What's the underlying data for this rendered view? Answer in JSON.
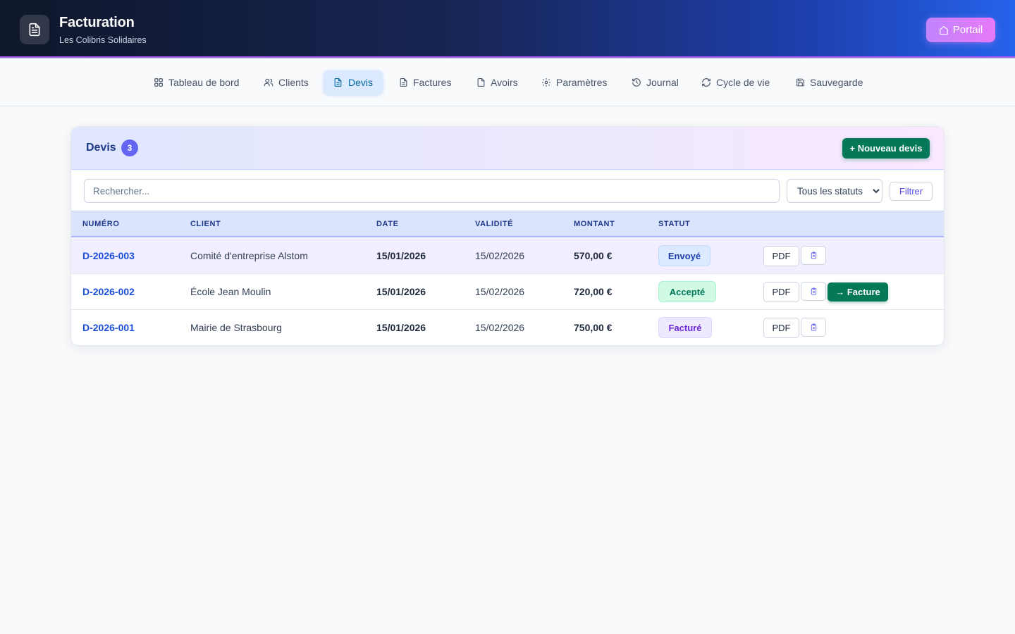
{
  "header": {
    "title": "Facturation",
    "subtitle": "Les Colibris Solidaires",
    "portal_label": "Portail"
  },
  "nav": {
    "items": [
      {
        "label": "Tableau de bord",
        "icon": "grid-icon"
      },
      {
        "label": "Clients",
        "icon": "users-icon"
      },
      {
        "label": "Devis",
        "icon": "document-icon",
        "active": true
      },
      {
        "label": "Factures",
        "icon": "document-icon"
      },
      {
        "label": "Avoirs",
        "icon": "document-icon"
      },
      {
        "label": "Paramètres",
        "icon": "gear-icon"
      },
      {
        "label": "Journal",
        "icon": "history-icon"
      },
      {
        "label": "Cycle de vie",
        "icon": "refresh-icon"
      },
      {
        "label": "Sauvegarde",
        "icon": "save-icon"
      }
    ]
  },
  "panel": {
    "title": "Devis",
    "count": "3",
    "new_button": "+ Nouveau devis",
    "search_placeholder": "Rechercher...",
    "status_filter": "Tous les statuts",
    "filter_button": "Filtrer"
  },
  "table": {
    "headers": [
      "NUMÉRO",
      "CLIENT",
      "DATE",
      "VALIDITÉ",
      "MONTANT",
      "STATUT"
    ],
    "rows": [
      {
        "numero": "D-2026-003",
        "client": "Comité d'entreprise Alstom",
        "date": "15/01/2026",
        "validite": "15/02/2026",
        "montant": "570,00 €",
        "statut": "Envoyé",
        "status_color": "#dbeafe",
        "status_text_color": "#1e40af",
        "pdf": "PDF",
        "convert": ""
      },
      {
        "numero": "D-2026-002",
        "client": "École Jean Moulin",
        "date": "15/01/2026",
        "validite": "15/02/2026",
        "montant": "720,00 €",
        "statut": "Accepté",
        "status_color": "#d1fae5",
        "status_text_color": "#047857",
        "pdf": "PDF",
        "convert": "→ Facture"
      },
      {
        "numero": "D-2026-001",
        "client": "Mairie de Strasbourg",
        "date": "15/01/2026",
        "validite": "15/02/2026",
        "montant": "750,00 €",
        "statut": "Facturé",
        "status_color": "#ede9fe",
        "status_text_color": "#6d28d9",
        "pdf": "PDF",
        "convert": ""
      }
    ]
  },
  "colors": {
    "accent": "#047857",
    "brand_purple": "#c084fc",
    "link": "#1d4ed8"
  }
}
